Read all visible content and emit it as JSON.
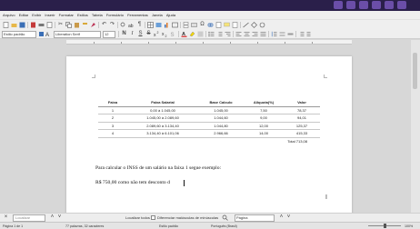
{
  "menu": [
    "Arquivo",
    "Editar",
    "Exibir",
    "Inserir",
    "Formatar",
    "Estilos",
    "Tabela",
    "Formulário",
    "Ferramentas",
    "Janela",
    "Ajuda"
  ],
  "toolbar": {
    "paragraph_style": "Estilo padrão",
    "font_name": "Liberation Serif",
    "font_size": "12"
  },
  "table": {
    "headers": [
      "Faixa",
      "Faixa Salarial",
      "Base Calculo",
      "Aliquota(%)",
      "Valor"
    ],
    "rows": [
      [
        "1",
        "0,00 à 1.045,00",
        "1.045,00",
        "7,50",
        "78,37"
      ],
      [
        "2",
        "1.045,00 à 2.089,60",
        "1.044,60",
        "9,00",
        "94,01"
      ],
      [
        "3",
        "2.089,60 à 3.134,40",
        "1.044,80",
        "12,00",
        "125,37"
      ],
      [
        "4",
        "3.134,40 à 6.101,06",
        "2.966,66",
        "14,00",
        "415,33"
      ]
    ],
    "total": "Total 713,08"
  },
  "body": {
    "line1": "Para calcular o INSS de um salário na faixa 1 segue exemplo:",
    "line2": "R$ 750,00 como não tem desconto d"
  },
  "findbar": {
    "placeholder": "Localizar",
    "whole_words": "Localizar todos",
    "match_case": "Diferenciar maiúsculas de minúsculas",
    "style_option": "Página"
  },
  "status": {
    "page": "Página 1 de 1",
    "words": "77 palavras, 32 caracteres",
    "style": "Estilo padrão",
    "language": "Português (Brasil)",
    "zoom": "100%"
  },
  "colors": {
    "highlight_yellow": "#f5d800",
    "font_red": "#d62020"
  }
}
